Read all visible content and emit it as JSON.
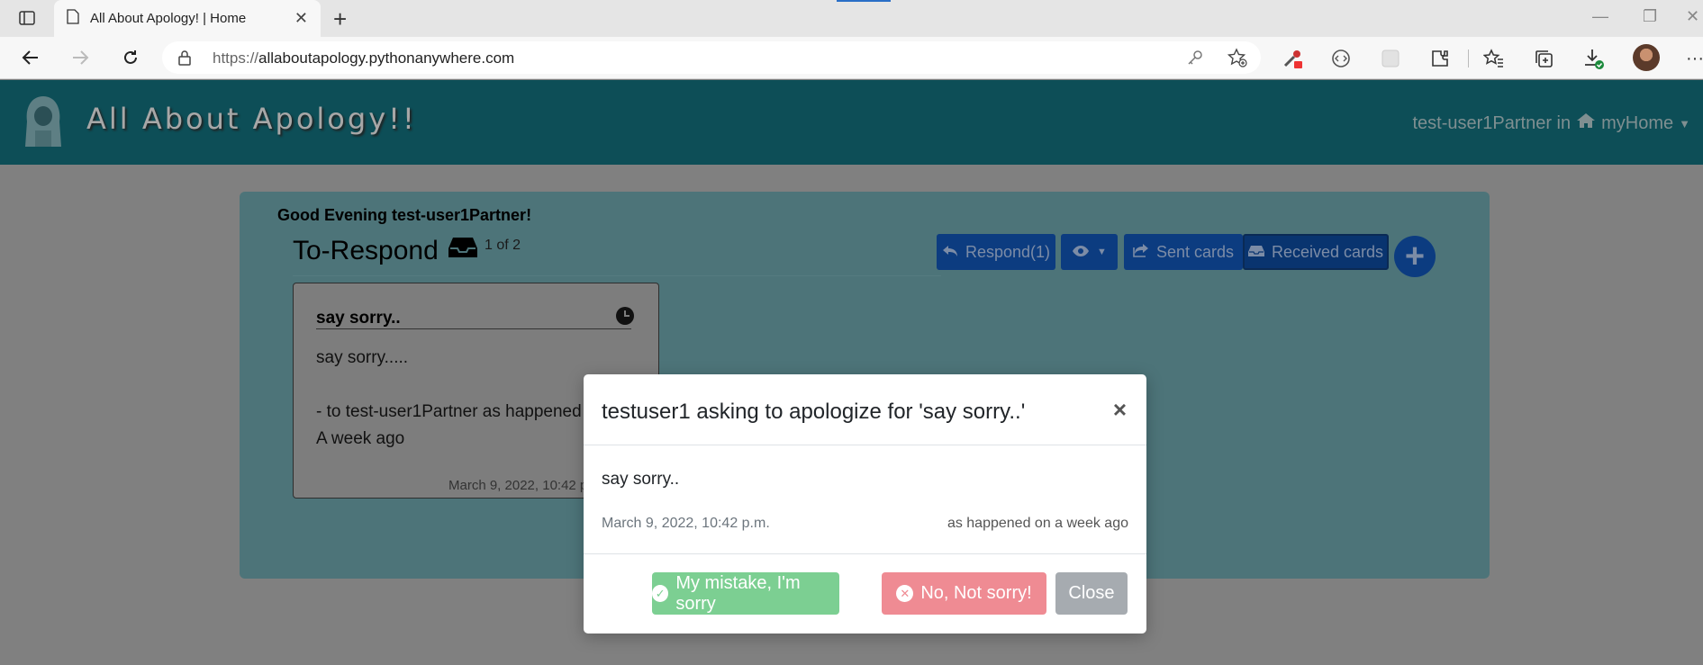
{
  "browser": {
    "tab_title": "All About Apology! | Home",
    "url_host": "allaboutapology.pythonanywhere.com",
    "url_scheme": "https://"
  },
  "site": {
    "brand": "All About Apology!!",
    "user_nav_user": "test-user1Partner in",
    "user_nav_home": "myHome"
  },
  "page": {
    "greeting": "Good Evening test-user1Partner!",
    "section_title": "To-Respond",
    "pager": "1 of 2",
    "buttons": {
      "respond": "Respond(1)",
      "sent": "Sent cards",
      "received": "Received cards"
    },
    "card": {
      "title": "say sorry..",
      "body": "say sorry.....",
      "to": "- to test-user1Partner as happened",
      "ago": "A week ago",
      "date": "March 9, 2022, 10:42 p.m."
    }
  },
  "modal": {
    "title": "testuser1 asking to apologize for 'say sorry..'",
    "close_x": "×",
    "message": "say sorry..",
    "date": "March 9, 2022, 10:42 p.m.",
    "happened": "as happened on a week ago",
    "btn_ok": "My mistake, I'm sorry",
    "btn_no": "No, Not sorry!",
    "btn_close": "Close"
  },
  "colors": {
    "header": "#0d4e57",
    "panel": "#4d7479",
    "success": "#7ccf92",
    "danger": "#ef8b93",
    "secondary": "#a6abb0"
  }
}
